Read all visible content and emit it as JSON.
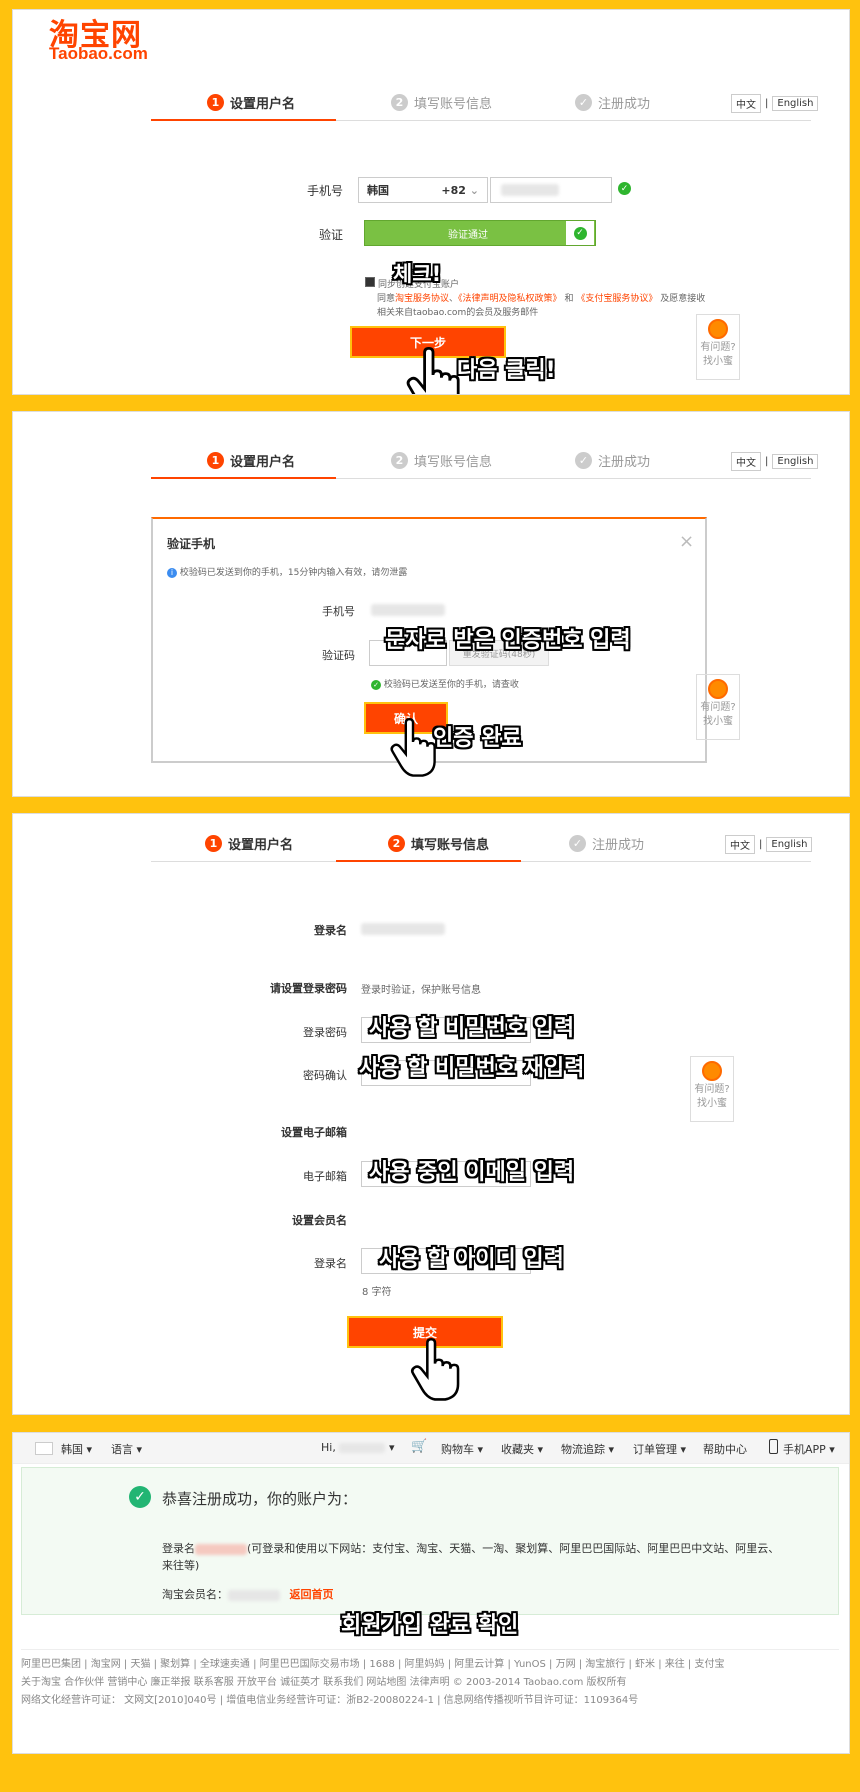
{
  "colors": {
    "background": "#ffc20e",
    "accent": "#ff4400",
    "success": "#2fb52f"
  },
  "logo": {
    "cn": "淘宝网",
    "en": "Taobao.com"
  },
  "steps": {
    "s1": "设置用户名",
    "s2": "填写账号信息",
    "s3": "注册成功",
    "n1": "1",
    "n2": "2"
  },
  "lang": {
    "zh": "中文",
    "sep": "|",
    "en": "English"
  },
  "panel1": {
    "phone_label": "手机号",
    "country": "韩国",
    "code": "+82",
    "verify_label": "验证",
    "verify_passed": "验证通过",
    "agree_line1": "同步创建支付宝账户",
    "agree_line2_prefix": "同意",
    "agree_link1": "淘宝服务协议",
    "agree_sep": "、",
    "agree_link2": "《法律声明及隐私权政策》",
    "agree_and": "和",
    "agree_link3": "《支付宝服务协议》",
    "agree_suffix": "及愿意接收",
    "agree_line3": "相关来自taobao.com的会员及服务邮件",
    "next_button": "下一步",
    "annot_check": "체크!",
    "annot_click": "다음 클릭!"
  },
  "panel2": {
    "dialog_title": "验证手机",
    "notice": "校验码已发送到你的手机，15分钟内输入有效，请勿泄露",
    "phone_label": "手机号",
    "code_label": "验证码",
    "resend": "重发验证码(48秒)",
    "sent_notice": "校验码已发送至你的手机，请查收",
    "confirm_button": "确认",
    "annot_input": "문자로 받은 인증번호 입력",
    "annot_done": "인증 완료"
  },
  "panel3": {
    "login_name_label": "登录名",
    "set_password_label": "请设置登录密码",
    "password_hint": "登录时验证，保护账号信息",
    "login_password_label": "登录密码",
    "confirm_password_label": "密码确认",
    "set_email_label": "设置电子邮箱",
    "email_label": "电子邮箱",
    "set_member_label": "设置会员名",
    "member_name_label": "登录名",
    "char_count": "8 字符",
    "submit_button": "提交",
    "annot_pw": "사용 할 비밀번호 입력",
    "annot_pw2": "사용 할 비밀번호 재입력",
    "annot_email": "사용 중인 이메일 입력",
    "annot_id": "사용 할 아이디 입력"
  },
  "help": {
    "line1": "有问题?",
    "line2": "找小蜜"
  },
  "panel4": {
    "nav": {
      "country": "韩国 ▾",
      "language": "语言 ▾",
      "hi": "Hi,",
      "cart": "购物车 ▾",
      "favorites": "收藏夹 ▾",
      "logistics": "物流追踪 ▾",
      "orders": "订单管理 ▾",
      "help": "帮助中心",
      "mobile": "手机APP ▾"
    },
    "success_title": "恭喜注册成功，你的账户为：",
    "login_name_prefix": "登录名",
    "login_name_desc": "(可登录和使用以下网站：支付宝、淘宝、天猫、一淘、聚划算、阿里巴巴国际站、阿里巴巴中文站、阿里云、",
    "login_name_desc2": "来往等)",
    "member_name_prefix": "淘宝会员名：",
    "back_home": "返回首页",
    "annot_done": "회원가입 완료 확인",
    "footer1": "阿里巴巴集团 | 淘宝网 | 天猫 | 聚划算 | 全球速卖通 | 阿里巴巴国际交易市场 | 1688 | 阿里妈妈 | 阿里云计算 | YunOS | 万网 | 淘宝旅行 | 虾米 | 来往 | 支付宝",
    "footer2": "关于淘宝  合作伙伴  营销中心  廉正举报  联系客服  开放平台  诚征英才  联系我们  网站地图  法律声明        © 2003-2014 Taobao.com 版权所有",
    "footer3": "网络文化经营许可证：  文网文[2010]040号  |  增值电信业务经营许可证：浙B2-20080224-1  |  信息网络传播视听节目许可证：1109364号"
  }
}
